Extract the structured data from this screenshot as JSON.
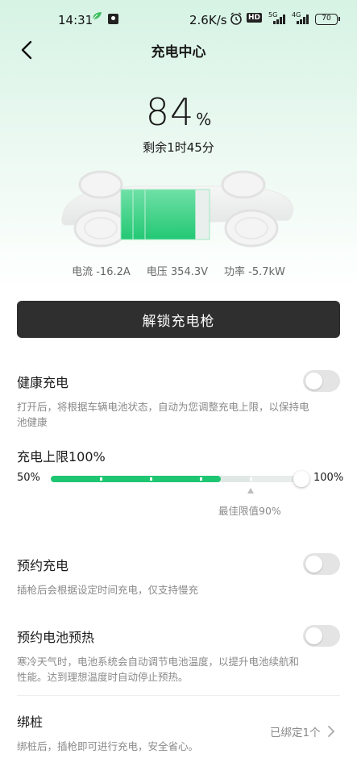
{
  "status_bar": {
    "time": "14:31",
    "speed": "2.6K/s",
    "hd": "HD",
    "sig1": "5G",
    "sig2": "4G",
    "battery": "70"
  },
  "header": {
    "title": "充电中心"
  },
  "charge": {
    "percent": "84",
    "unit": "%",
    "remaining": "剩余1时45分",
    "level_fraction": 0.84
  },
  "metrics": {
    "current": "电流 -16.2A",
    "voltage": "电压 354.3V",
    "power": "功率 -5.7kW"
  },
  "unlock_label": "解锁充电枪",
  "healthy": {
    "title": "健康充电",
    "desc": "打开后，将根据车辆电池状态，自动为您调整充电上限，以保持电池健康",
    "enabled": false
  },
  "limit": {
    "title": "充电上限100%",
    "min_label": "50%",
    "max_label": "100%",
    "best_label": "最佳限值90%",
    "value_percent": 100,
    "best_percent": 90
  },
  "reserve": {
    "title": "预约充电",
    "desc": "插枪后会根据设定时间充电，仅支持慢充",
    "enabled": false
  },
  "preheat": {
    "title": "预约电池预热",
    "desc": "寒冷天气时，电池系统会自动调节电池温度，以提升电池续航和性能。达到理想温度时自动停止预热。",
    "enabled": false
  },
  "bind": {
    "title": "绑桩",
    "desc": "绑桩后，插枪即可进行充电，安全省心。",
    "status": "已绑定1个"
  },
  "colors": {
    "accent": "#1fc672",
    "button": "#2f2f2f"
  }
}
